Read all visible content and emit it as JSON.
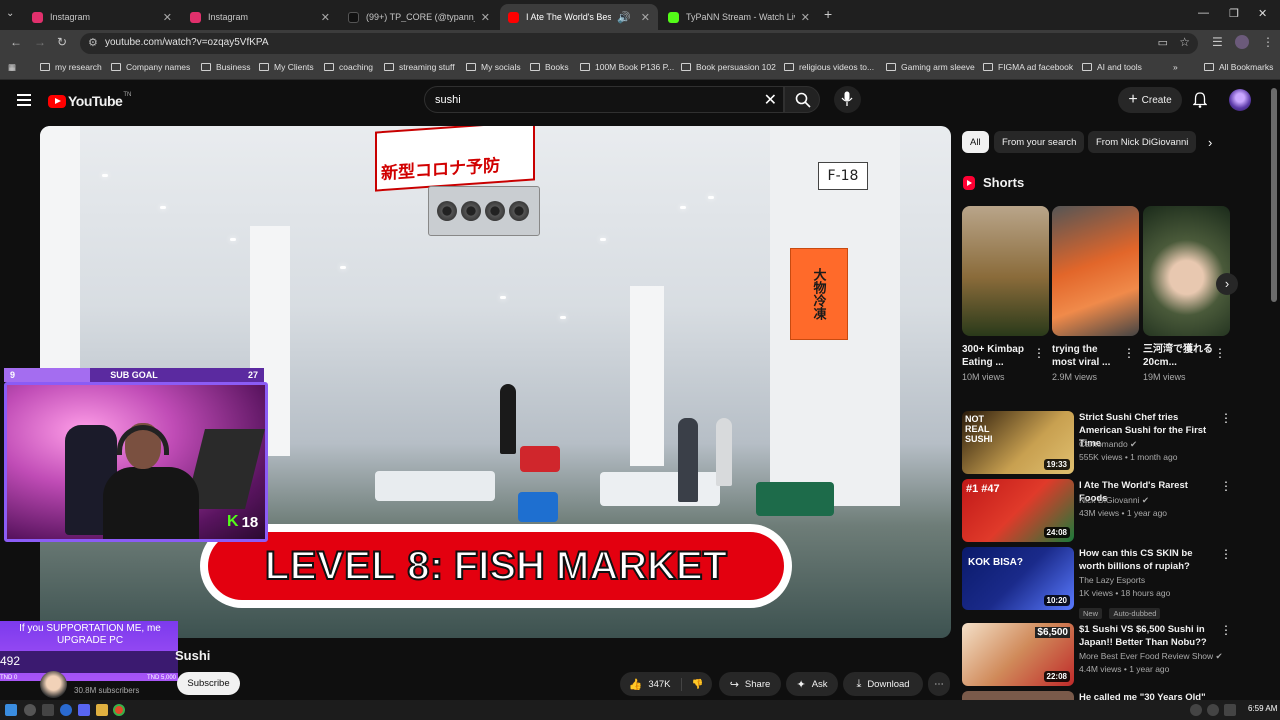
{
  "browser": {
    "tabs": [
      {
        "title": "Instagram",
        "color": "#e1306c"
      },
      {
        "title": "Instagram",
        "color": "#e1306c"
      },
      {
        "title": "(99+) TP_CORE (@typann_core)",
        "color": "#111111"
      },
      {
        "title": "I Ate The World's Best Sushi",
        "color": "#ff0000"
      },
      {
        "title": "TyPaNN Stream - Watch Live o",
        "color": "#53fc18"
      }
    ],
    "new_tab": "+",
    "url": "youtube.com/watch?v=ozqay5VfKPA",
    "bookmarks": [
      "my research",
      "Company names",
      "Business",
      "My Clients",
      "coaching",
      "streaming stuff",
      "My socials",
      "Books",
      "100M Book P136 P...",
      "Book persuasion 102",
      "religious videos to...",
      "Gaming arm sleeve",
      "FIGMA ad facebook",
      "AI and tools"
    ],
    "all_bookmarks": "All Bookmarks"
  },
  "youtube": {
    "logo_text": "YouTube",
    "logo_tm": "TN",
    "search_query": "sushi",
    "create_label": "Create"
  },
  "video": {
    "banner_level": "LEVEL 8:",
    "banner_name": "FISH MARKET",
    "sign_red": "新型コロナ予防",
    "sign_f18": "F-18",
    "sign_orange": "大物冷凍",
    "title_fragment": "Sushi",
    "channel_subs": "30.8M subscribers",
    "subscribe_label": "Subscribe",
    "likes": "347K",
    "share_label": "Share",
    "ask_label": "Ask",
    "download_label": "Download"
  },
  "overlay": {
    "subgoal_current": "9",
    "subgoal_label": "SUB GOAL",
    "subgoal_target": "27",
    "subgoal_progress": 0.33,
    "kick_count": "18",
    "support_msg": "If you SUPPORTATION ME, me UPGRADE PC",
    "support_amount": "492",
    "support_min": "TND 0",
    "support_max": "TND 5,000"
  },
  "sidebar": {
    "chips": [
      "All",
      "From your search",
      "From Nick DiGiovanni"
    ],
    "shorts_header": "Shorts",
    "shorts": [
      {
        "title": "300+ Kimbap Eating ...",
        "views": "10M views",
        "color": "#8a6b3a"
      },
      {
        "title": "trying the most viral ...",
        "views": "2.9M views",
        "color": "#e2662a"
      },
      {
        "title": "三河湾で獲れる20cm...",
        "views": "19M views",
        "color": "#4a5a3a"
      }
    ],
    "videos": [
      {
        "title": "Strict Sushi Chef tries American Sushi for the First Time",
        "channel": "Cantomando",
        "meta": "555K views • 1 month ago",
        "duration": "19:33",
        "color": "#c8a050",
        "thumb_text": "NOT REAL SUSHI",
        "badges": []
      },
      {
        "title": "I Ate The World's Rarest Foods",
        "channel": "Nick DiGiovanni",
        "meta": "43M views • 1 year ago",
        "duration": "24:08",
        "color": "#c01818",
        "thumb_text": "#1 #47",
        "badges": []
      },
      {
        "title": "How can this CS SKIN be worth billions of rupiah?",
        "channel": "The Lazy Esports",
        "meta": "1K views • 18 hours ago",
        "duration": "10:20",
        "color": "#1a2a8a",
        "thumb_text": "KOK BISA?",
        "badges": [
          "New",
          "Auto-dubbed"
        ]
      },
      {
        "title": "$1 Sushi VS $6,500 Sushi in Japan!! Better Than Nobu??",
        "channel": "More Best Ever Food Review Show",
        "meta": "4.4M views • 1 year ago",
        "duration": "22:08",
        "color": "#d08a5a",
        "thumb_text": "$6,500",
        "badges": []
      },
      {
        "title": "He called me \"30 Years Old\"",
        "channel": "",
        "meta": "",
        "duration": "",
        "color": "#7a5a4a",
        "thumb_text": "",
        "badges": []
      }
    ]
  },
  "taskbar": {
    "clock": "6:59 AM"
  }
}
